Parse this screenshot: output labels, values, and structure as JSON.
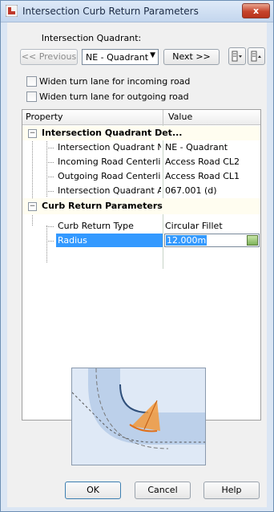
{
  "window": {
    "title": "Intersection Curb Return Parameters",
    "close_label": "x"
  },
  "quadrant": {
    "label": "Intersection Quadrant:",
    "previous_label": "<< Previous",
    "selected": "NE - Quadrant",
    "next_label": "Next >>"
  },
  "options": {
    "widen_incoming": "Widen turn lane for incoming road",
    "widen_outgoing": "Widen turn lane for outgoing road"
  },
  "grid": {
    "col_property": "Property",
    "col_value": "Value",
    "cat_quadrant": "Intersection Quadrant Det...",
    "rows_quadrant": [
      {
        "property": "Intersection Quadrant N...",
        "value": "NE - Quadrant"
      },
      {
        "property": "Incoming Road Centerli...",
        "value": "Access Road CL2"
      },
      {
        "property": "Outgoing Road Centerli...",
        "value": "Access Road CL1"
      },
      {
        "property": "Intersection Quadrant A...",
        "value": "067.001 (d)"
      }
    ],
    "cat_curb": "Curb Return Parameters",
    "rows_curb": [
      {
        "property": "Curb Return Type",
        "value": "Circular Fillet"
      },
      {
        "property": "Radius",
        "value": "12.000m"
      }
    ]
  },
  "buttons": {
    "ok": "OK",
    "cancel": "Cancel",
    "help": "Help"
  },
  "colors": {
    "accent": "#3399ff",
    "preview_road": "#bcd0ea",
    "preview_arc": "#f39a3c"
  }
}
